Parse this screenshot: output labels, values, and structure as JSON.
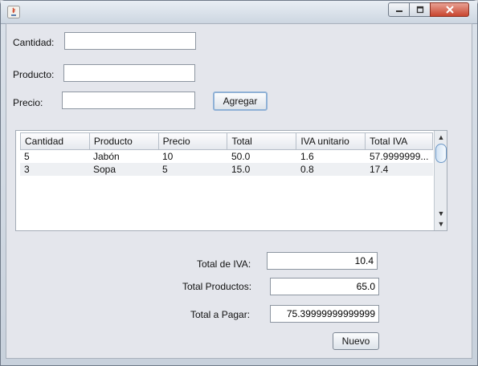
{
  "window": {
    "title": "",
    "controls": {
      "minimize": "minimize",
      "maximize": "maximize",
      "close": "close"
    }
  },
  "form": {
    "cantidad_label": "Cantidad:",
    "cantidad_value": "",
    "producto_label": "Producto:",
    "producto_value": "",
    "precio_label": "Precio:",
    "precio_value": "",
    "agregar_label": "Agregar"
  },
  "table": {
    "columns": [
      "Cantidad",
      "Producto",
      "Precio",
      "Total",
      "IVA unitario",
      "Total IVA"
    ],
    "rows": [
      [
        "5",
        "Jabón",
        "10",
        "50.0",
        "1.6",
        "57.9999999..."
      ],
      [
        "3",
        "Sopa",
        "5",
        "15.0",
        "0.8",
        "17.4"
      ]
    ]
  },
  "totals": {
    "iva_label": "Total de IVA:",
    "iva_value": "10.4",
    "productos_label": "Total Productos:",
    "productos_value": "65.0",
    "pagar_label": "Total a Pagar:",
    "pagar_value": "75.39999999999999",
    "nuevo_label": "Nuevo"
  },
  "colors": {
    "window_bg": "#e4e6ec",
    "close_button": "#c8452f",
    "focus_ring": "#8fb1d6"
  }
}
